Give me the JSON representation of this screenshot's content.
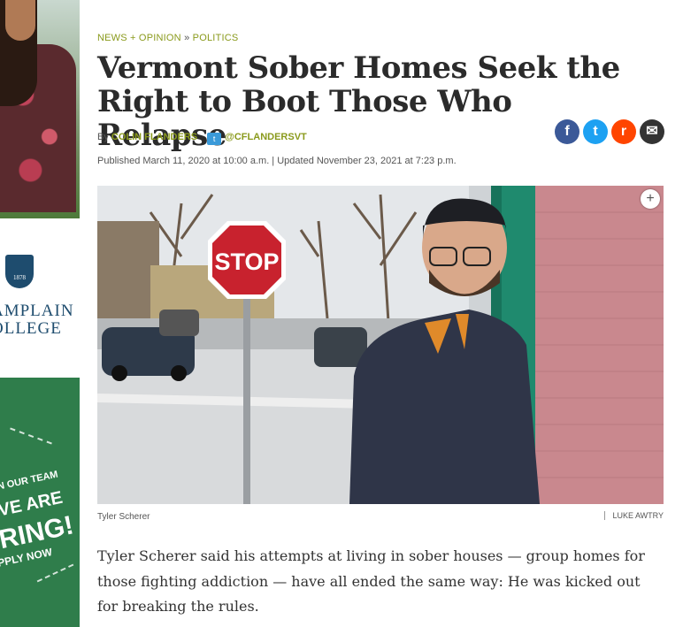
{
  "sidebar": {
    "logo_year": "1878",
    "logo_line1": "AMPLAIN",
    "logo_line2": "OLLEGE",
    "ad_line1": "N OUR TEAM",
    "ad_line2": "VE ARE",
    "ad_line3": "RING!",
    "ad_line4": "PPLY NOW"
  },
  "article": {
    "breadcrumb_section": "NEWS + OPINION",
    "breadcrumb_sep": "»",
    "breadcrumb_sub": "POLITICS",
    "headline": "Vermont Sober Homes Seek the Right to Boot Those Who Relapse",
    "by_label": "By",
    "author": "COLIN FLANDERS",
    "twitter_handle": "@CFLANDERSVT",
    "published": "Published March 11, 2020 at 10:00 a.m. | Updated November 23, 2021 at 7:23 p.m.",
    "photo_sign": "STOP",
    "photo_caption": "Tyler Scherer",
    "photo_credit": "LUKE AWTRY",
    "body": "Tyler Scherer said his attempts at living in sober houses — group homes for those fighting addiction — have all ended the same way: He was kicked out for breaking the rules."
  },
  "share": [
    {
      "icon": "facebook-icon",
      "glyph": "f",
      "color": "#3b5998"
    },
    {
      "icon": "twitter-icon",
      "glyph": "t",
      "color": "#1da1f2"
    },
    {
      "icon": "reddit-icon",
      "glyph": "r",
      "color": "#ff4500"
    },
    {
      "icon": "email-icon",
      "glyph": "✉",
      "color": "#333333"
    }
  ],
  "colors": {
    "accent": "#8a9a1c",
    "ad_green": "#2f7d4b",
    "logo_blue": "#1e4c6e"
  }
}
